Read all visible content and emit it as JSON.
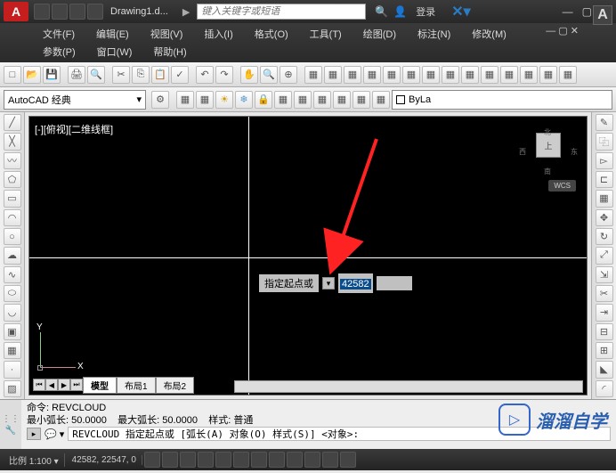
{
  "title": {
    "filename": "Drawing1.d...",
    "search_placeholder": "键入关键字或短语",
    "login": "登录"
  },
  "menus": {
    "row1": [
      "文件(F)",
      "编辑(E)",
      "视图(V)",
      "插入(I)",
      "格式(O)",
      "工具(T)",
      "绘图(D)",
      "标注(N)",
      "修改(M)"
    ],
    "row2": [
      "参数(P)",
      "窗口(W)",
      "帮助(H)"
    ]
  },
  "workspace": {
    "name": "AutoCAD 经典",
    "bylayer": "ByLa"
  },
  "canvas": {
    "view_label": "[-][俯视][二维线框]",
    "cube_face": "上",
    "compass": {
      "n": "北",
      "s": "南",
      "e": "东",
      "w": "西"
    },
    "wcs": "WCS",
    "ucs": {
      "x": "X",
      "y": "Y"
    }
  },
  "dynamic_input": {
    "prompt": "指定起点或",
    "value": "42582"
  },
  "layout_tabs": {
    "active": "模型",
    "tabs": [
      "布局1",
      "布局2"
    ]
  },
  "command": {
    "line1": "命令: REVCLOUD",
    "line2_a": "最小弧长: 50.0000",
    "line2_b": "最大弧长: 50.0000",
    "line2_c": "样式: 普通",
    "input": "REVCLOUD 指定起点或 [弧长(A) 对象(O) 样式(S)] <对象>:"
  },
  "status": {
    "scale_label": "比例",
    "scale": "1:100",
    "coords": "42582, 22547, 0"
  },
  "watermark": "溜溜自学"
}
